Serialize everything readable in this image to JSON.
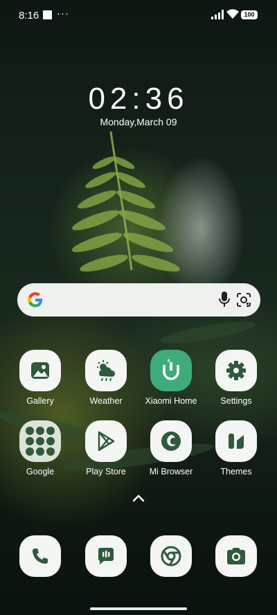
{
  "status_bar": {
    "time": "8:16",
    "dots": "···",
    "battery": "100"
  },
  "lock": {
    "clock": "02:36",
    "date": "Monday,March 09"
  },
  "search": {
    "mic_icon": "mic-icon",
    "lens_icon": "lens-icon"
  },
  "apps_row1": [
    {
      "label": "Gallery",
      "icon": "gallery-icon"
    },
    {
      "label": "Weather",
      "icon": "weather-icon"
    },
    {
      "label": "Xiaomi Home",
      "icon": "xiaomi-home-icon"
    },
    {
      "label": "Settings",
      "icon": "gear-icon"
    }
  ],
  "apps_row2": [
    {
      "label": "Google",
      "icon": "folder-icon"
    },
    {
      "label": "Play Store",
      "icon": "play-store-icon"
    },
    {
      "label": "Mi Browser",
      "icon": "browser-icon"
    },
    {
      "label": "Themes",
      "icon": "themes-icon"
    }
  ],
  "dock": [
    {
      "icon": "phone-icon"
    },
    {
      "icon": "messages-icon"
    },
    {
      "icon": "chrome-icon"
    },
    {
      "icon": "camera-icon"
    }
  ],
  "colors": {
    "icon_fg": "#2f5a3c",
    "icon_bg": "#f4f6f3",
    "accent": "#3fab7b"
  }
}
